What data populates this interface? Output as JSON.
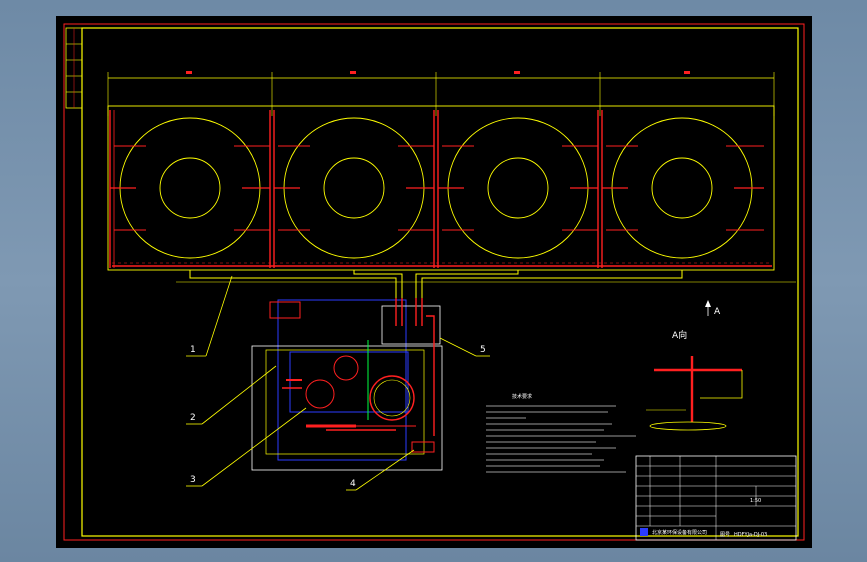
{
  "drawing": {
    "callouts": [
      "1",
      "2",
      "3",
      "4",
      "5"
    ],
    "view_label": "A向",
    "arrow_label": "A",
    "notes_title": "技术要求",
    "title_block": {
      "company": "北京某环保设备有限公司",
      "drawing_no": "HDFYJa-DJ-03",
      "scale": "1:50",
      "drawing_label": "图号"
    }
  },
  "colors": {
    "frame": "#ffff00",
    "tank": "#ffff00",
    "pipe_red": "#ff2020",
    "blue_room": "#2b3cff",
    "white_line": "#ffffff",
    "green": "#00ff40"
  }
}
